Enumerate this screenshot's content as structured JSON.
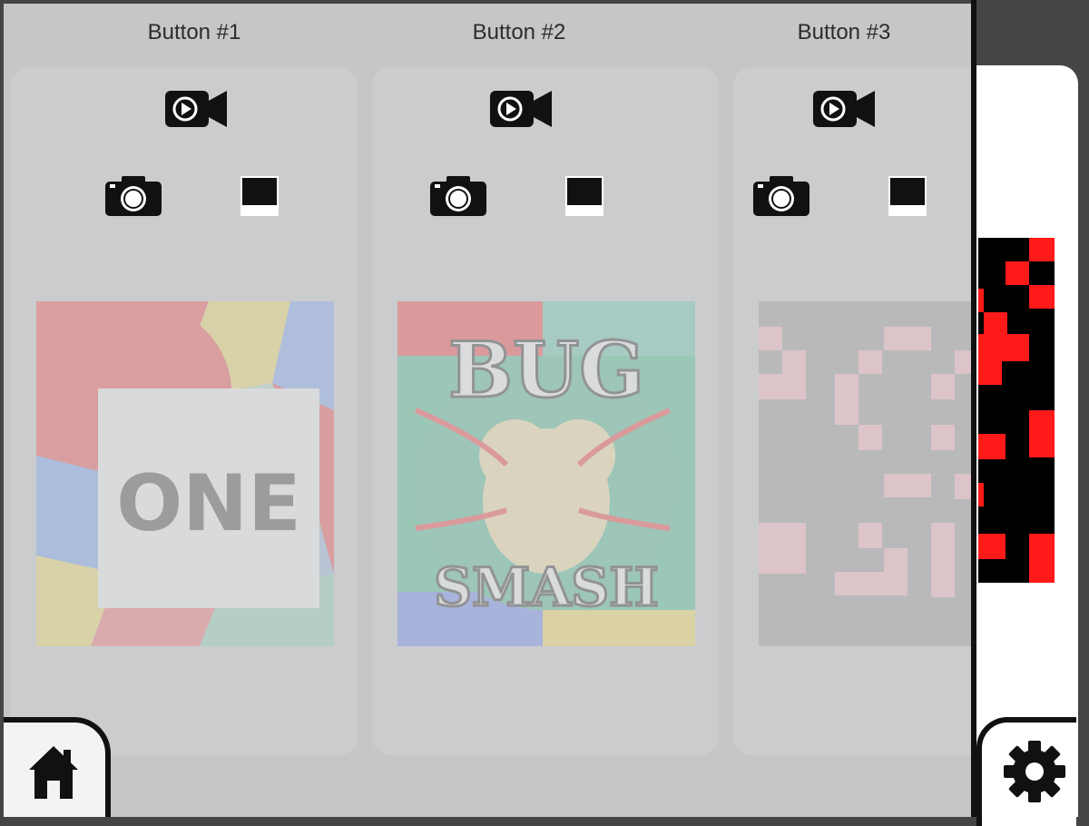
{
  "buttons": [
    {
      "title": "Button #1",
      "artwork_text": "ONE"
    },
    {
      "title": "Button #2",
      "artwork_text_top": "BUG",
      "artwork_text_bottom": "SMASH"
    },
    {
      "title": "Button #3"
    }
  ],
  "icons": {
    "record_video": "video-camera-icon",
    "take_photo": "camera-icon",
    "choose_image": "image-frame-icon",
    "home": "home-icon",
    "settings": "gear-icon"
  },
  "colors": {
    "overlay": "#c5c6c8",
    "card": "#cbccce",
    "accent_red": "#ff1a1a"
  }
}
